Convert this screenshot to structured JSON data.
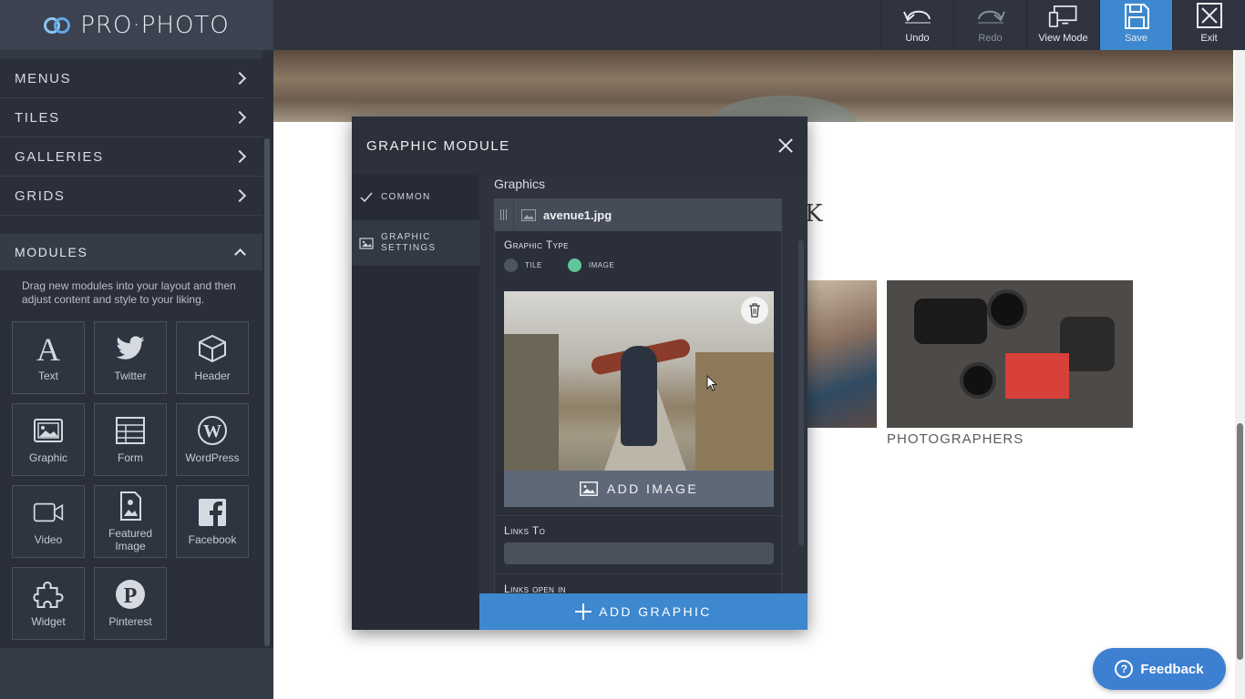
{
  "app": {
    "brand_left": "PRO",
    "brand_right": "PHOTO"
  },
  "toolbar": {
    "undo": "Undo",
    "redo": "Redo",
    "view_mode": "View Mode",
    "save": "Save",
    "exit": "Exit"
  },
  "sidebar": {
    "items": [
      {
        "label": "MENUS"
      },
      {
        "label": "TILES"
      },
      {
        "label": "GALLERIES"
      },
      {
        "label": "GRIDS"
      }
    ],
    "modules_title": "MODULES",
    "modules_desc": "Drag new modules into your layout and then adjust content and style to your liking.",
    "modules": [
      {
        "label": "Text",
        "icon": "text-icon"
      },
      {
        "label": "Twitter",
        "icon": "twitter-icon"
      },
      {
        "label": "Header",
        "icon": "cube-icon"
      },
      {
        "label": "Graphic",
        "icon": "image-icon"
      },
      {
        "label": "Form",
        "icon": "form-icon"
      },
      {
        "label": "WordPress",
        "icon": "wordpress-icon"
      },
      {
        "label": "Video",
        "icon": "video-icon"
      },
      {
        "label": "Featured Image",
        "icon": "featured-image-icon"
      },
      {
        "label": "Facebook",
        "icon": "facebook-icon"
      },
      {
        "label": "Widget",
        "icon": "puzzle-icon"
      },
      {
        "label": "Pinterest",
        "icon": "pinterest-icon"
      }
    ]
  },
  "canvas": {
    "title_fragment": "K",
    "caption": "PHOTOGRAPHERS"
  },
  "modal": {
    "title": "GRAPHIC MODULE",
    "tabs": [
      {
        "label": "COMMON",
        "icon": "check-icon"
      },
      {
        "label_line1": "GRAPHIC",
        "label_line2": "SETTINGS",
        "icon": "image-icon"
      }
    ],
    "graphics_label": "Graphics",
    "file_name": "avenue1.jpg",
    "graphic_type_label": "Graphic Type",
    "options": [
      {
        "label": "TILE",
        "selected": false
      },
      {
        "label": "IMAGE",
        "selected": true
      }
    ],
    "add_image": "ADD IMAGE",
    "links_to_label": "Links To",
    "links_to_value": "",
    "links_open_label": "Links open in",
    "add_graphic": "ADD GRAPHIC"
  },
  "feedback": {
    "label": "Feedback"
  },
  "colors": {
    "accent": "#3d88cf",
    "sidebar_bg": "#2a2f3a",
    "radio_on": "#5fc79a"
  }
}
